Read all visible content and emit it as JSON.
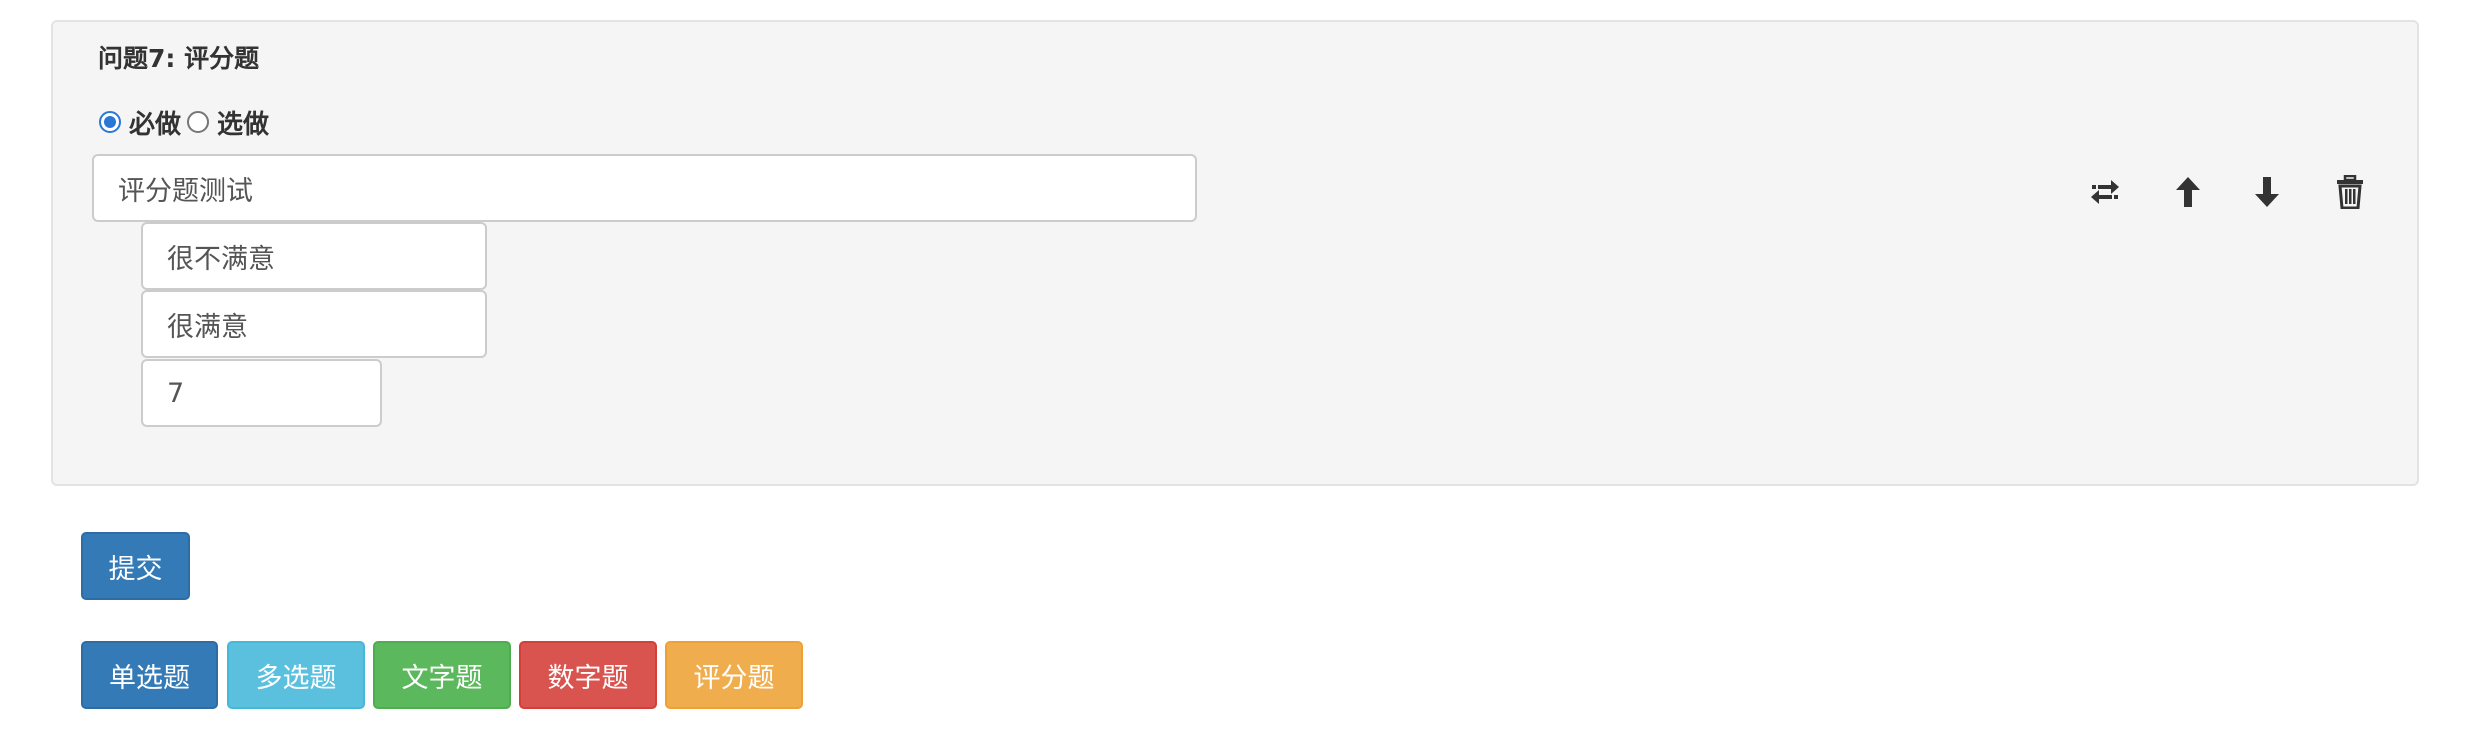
{
  "question": {
    "title": "问题7: 评分题",
    "required_label": "必做",
    "optional_label": "选做",
    "required_selected": true,
    "text_value": "评分题测试",
    "low_label_value": "很不满意",
    "high_label_value": "很满意",
    "scale_value": "7"
  },
  "actions": {
    "icons": [
      "swap-icon",
      "arrow-up-icon",
      "arrow-down-icon",
      "trash-icon"
    ]
  },
  "submit_label": "提交",
  "add_buttons": {
    "single_choice": "单选题",
    "multi_choice": "多选题",
    "text": "文字题",
    "number": "数字题",
    "rating": "评分题"
  },
  "colors": {
    "primary": "#337ab7",
    "info": "#5bc0de",
    "success": "#5cb85c",
    "danger": "#d9534f",
    "warning": "#f0ad4e",
    "panel_bg": "#f5f5f5"
  }
}
